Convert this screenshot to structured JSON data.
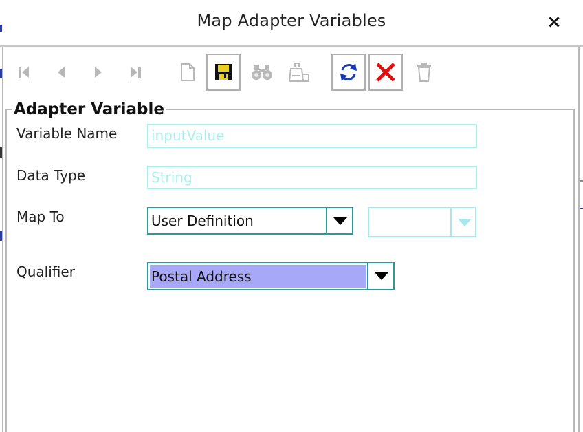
{
  "dialog": {
    "title": "Map Adapter Variables",
    "close_label": "×"
  },
  "toolbar": {
    "items": [
      {
        "name": "first-record",
        "icon": "skip-first-icon",
        "enabled": false
      },
      {
        "name": "previous-record",
        "icon": "prev-icon",
        "enabled": false
      },
      {
        "name": "next-record",
        "icon": "next-icon",
        "enabled": false
      },
      {
        "name": "last-record",
        "icon": "skip-last-icon",
        "enabled": false
      },
      {
        "name": "new-record",
        "icon": "new-document-icon",
        "enabled": false
      },
      {
        "name": "save",
        "icon": "floppy-disk-icon",
        "enabled": true
      },
      {
        "name": "find",
        "icon": "binoculars-icon",
        "enabled": false
      },
      {
        "name": "query",
        "icon": "query-flask-icon",
        "enabled": false
      },
      {
        "name": "refresh",
        "icon": "refresh-icon",
        "enabled": true
      },
      {
        "name": "cancel",
        "icon": "red-x-icon",
        "enabled": true
      },
      {
        "name": "delete",
        "icon": "trash-icon",
        "enabled": false
      }
    ]
  },
  "panel": {
    "legend": "Adapter Variable",
    "variable_name_label": "Variable Name",
    "variable_name_value": "inputValue",
    "data_type_label": "Data Type",
    "data_type_value": "String",
    "map_to_label": "Map To",
    "map_to_value": "User Definition",
    "map_to_secondary_value": "",
    "qualifier_label": "Qualifier",
    "qualifier_value": "Postal Address"
  },
  "colors": {
    "disabled_text": "#a8f0f0",
    "combo_border": "#2a9a9a",
    "selection_highlight": "#a8a8f8",
    "cancel_red": "#e01010",
    "refresh_blue": "#1a3ab8"
  }
}
